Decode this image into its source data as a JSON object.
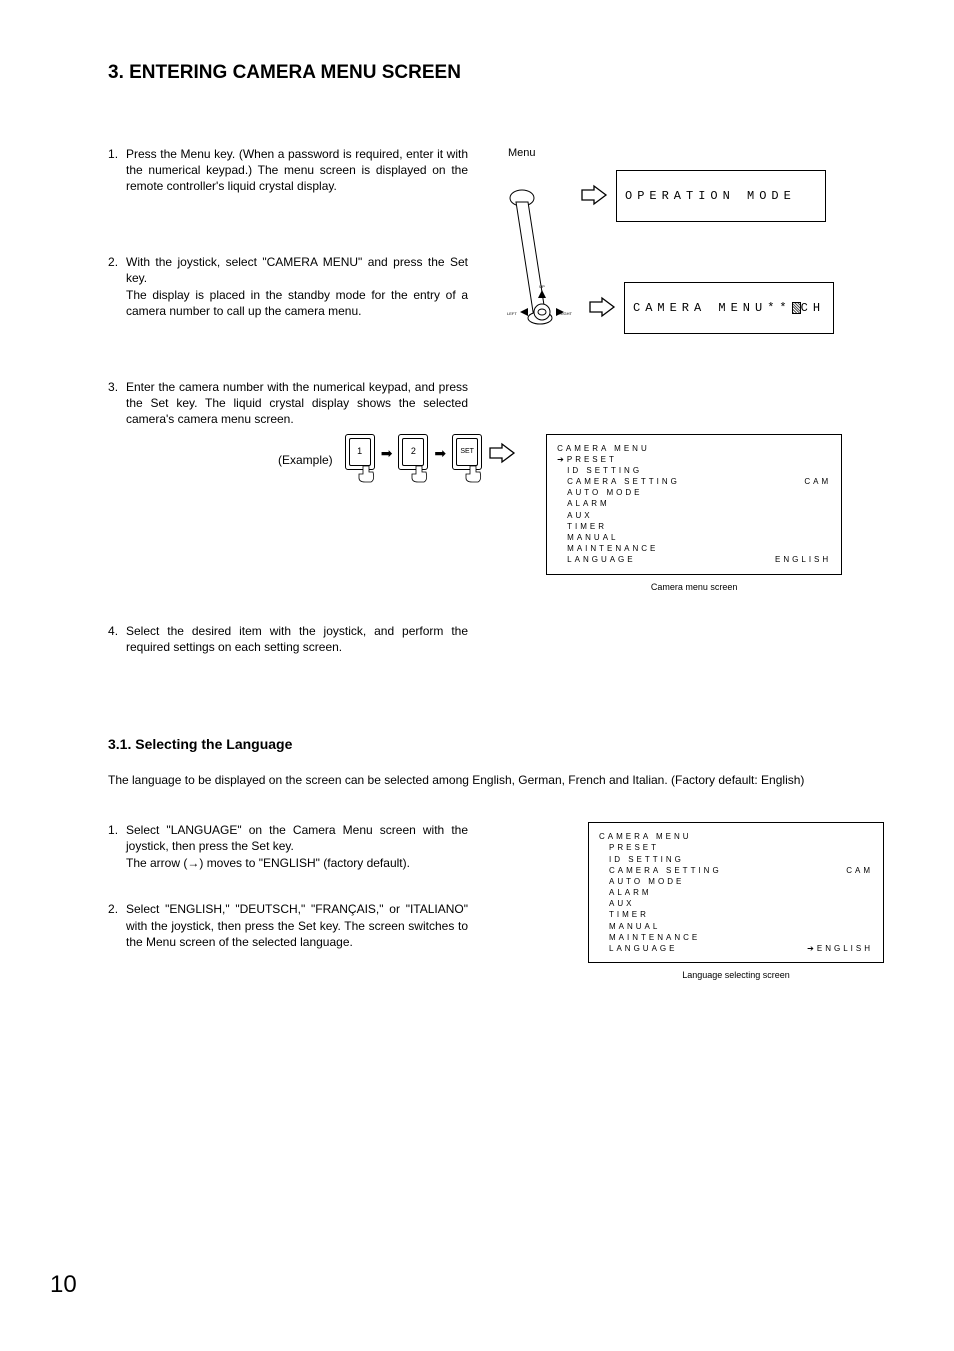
{
  "heading": "3. ENTERING CAMERA MENU SCREEN",
  "steps_a": [
    "Press the Menu key. (When a password is required, enter it with the numerical keypad.) The menu screen is displayed on the remote controller's liquid crystal display.",
    "With the joystick, select \"CAMERA MENU\" and press the Set key.\nThe display is placed in the standby mode for the entry of a camera number to call up the camera menu.",
    "Enter the camera number with the numerical keypad, and press the Set key. The liquid crystal display shows the selected camera's camera menu screen.",
    "Select the desired item with the joystick, and perform the required settings on each setting screen."
  ],
  "menu_label": "Menu",
  "lcd1": "OPERATION MODE",
  "lcd2_pre": "CAMERA MENU**",
  "lcd2_post": "CH",
  "joy": {
    "up": "UP",
    "left": "LEFT",
    "right": "RIGHT"
  },
  "example_label": "(Example)",
  "keys": {
    "k1": "1",
    "k2": "2",
    "set": "SET"
  },
  "menu1": {
    "title": "CAMERA MENU",
    "items": [
      {
        "label": "PRESET",
        "value": "",
        "arrow": true
      },
      {
        "label": "ID SETTING",
        "value": ""
      },
      {
        "label": "CAMERA SETTING",
        "value": "CAM"
      },
      {
        "label": "AUTO MODE",
        "value": ""
      },
      {
        "label": "ALARM",
        "value": ""
      },
      {
        "label": "AUX",
        "value": ""
      },
      {
        "label": "TIMER",
        "value": ""
      },
      {
        "label": "MANUAL",
        "value": ""
      },
      {
        "label": "MAINTENANCE",
        "value": ""
      },
      {
        "label": "LANGUAGE",
        "value": "ENGLISH"
      }
    ],
    "caption": "Camera menu screen"
  },
  "sub_heading": "3.1. Selecting the Language",
  "intro": "The language to be displayed on the screen can be selected among English, German, French and Italian. (Factory default: English)",
  "steps_b": {
    "s1_a": "Select \"LANGUAGE\" on the Camera Menu screen with the joystick, then press the Set key.",
    "s1_b_pre": "The arrow (",
    "s1_b_post": ") moves to \"ENGLISH\" (factory default).",
    "s2": "Select \"ENGLISH,\" \"DEUTSCH,\" \"FRANÇAIS,\" or \"ITALIANO\" with the joystick, then press the Set key. The screen switches to the Menu screen of the selected language."
  },
  "menu2": {
    "title": "CAMERA MENU",
    "items": [
      {
        "label": "PRESET",
        "value": ""
      },
      {
        "label": "ID SETTING",
        "value": ""
      },
      {
        "label": "CAMERA SETTING",
        "value": "CAM"
      },
      {
        "label": "AUTO MODE",
        "value": ""
      },
      {
        "label": "ALARM",
        "value": ""
      },
      {
        "label": "AUX",
        "value": ""
      },
      {
        "label": "TIMER",
        "value": ""
      },
      {
        "label": "MANUAL",
        "value": ""
      },
      {
        "label": "MAINTENANCE",
        "value": ""
      },
      {
        "label": "LANGUAGE",
        "value": "ENGLISH",
        "arrow_value": true
      }
    ],
    "caption": "Language selecting screen"
  },
  "page_number": "10"
}
